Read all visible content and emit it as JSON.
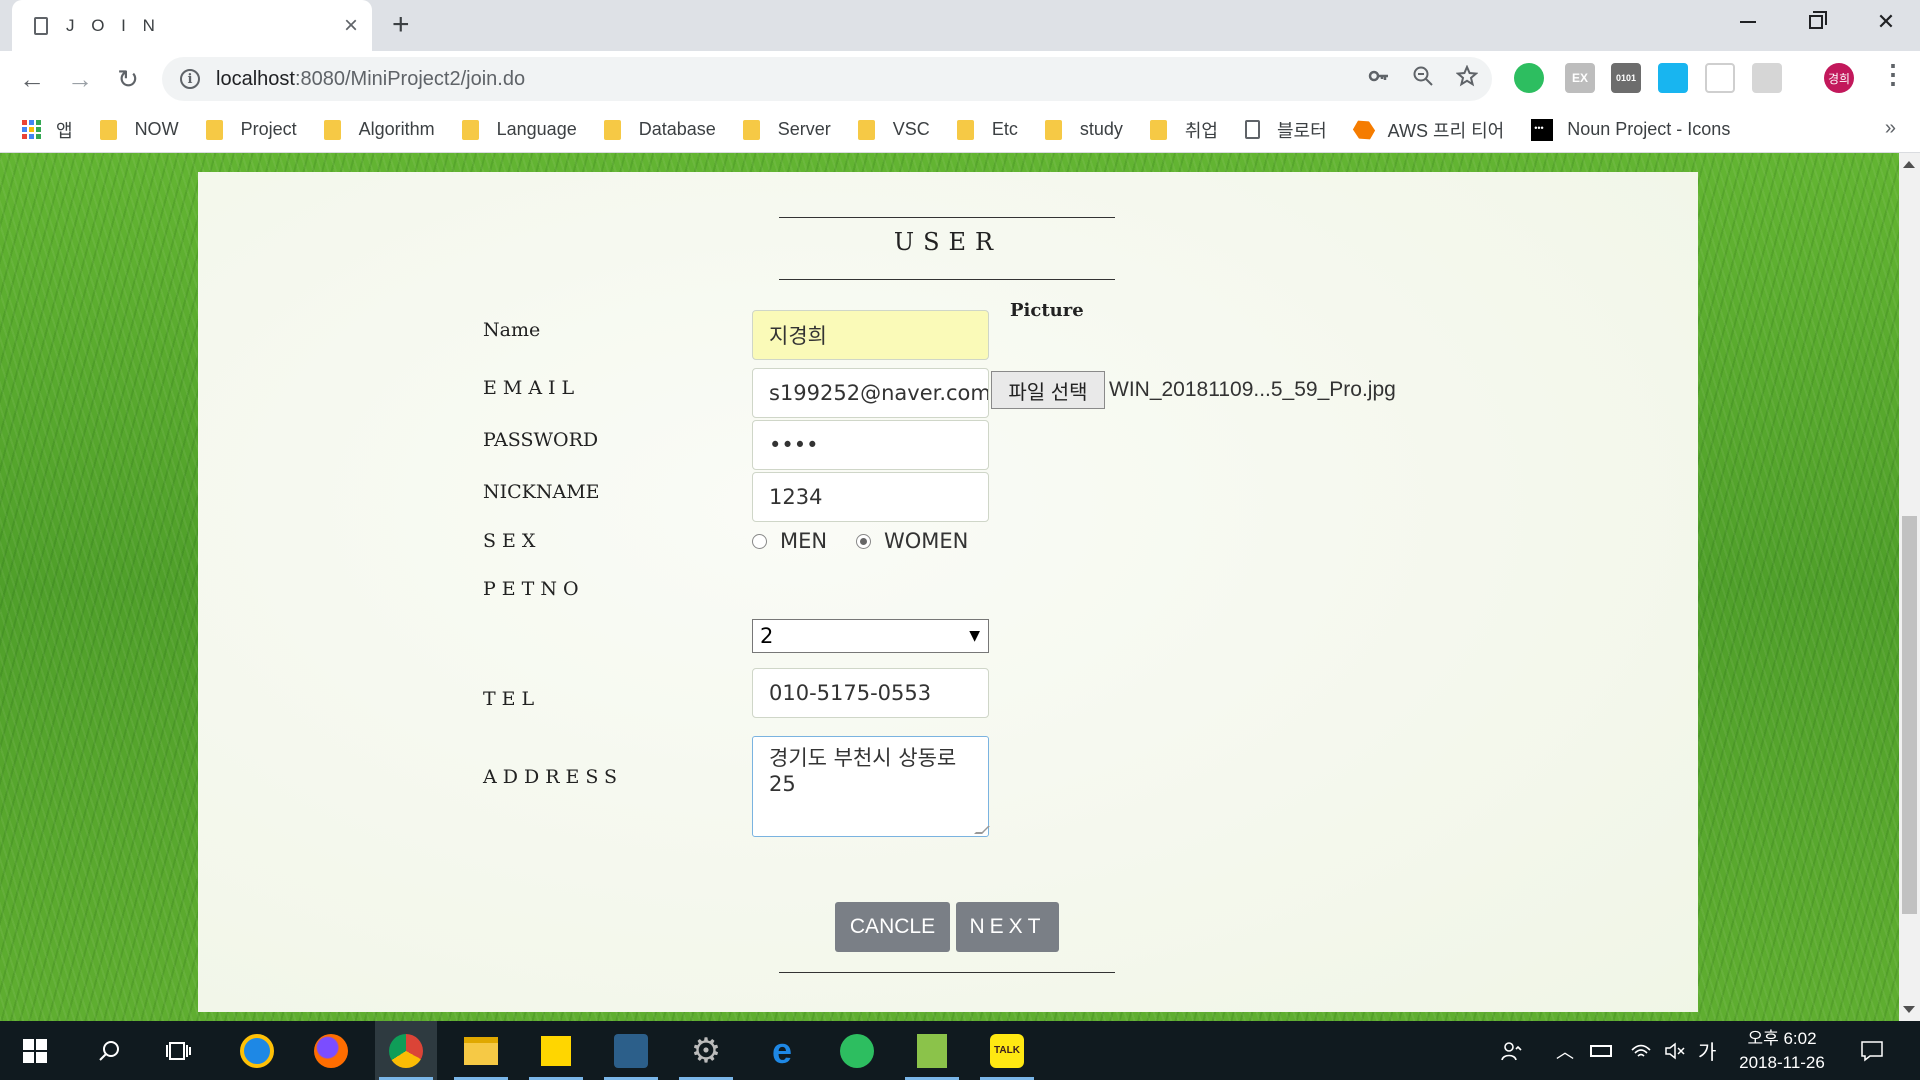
{
  "browser": {
    "tab_title": "J O I N",
    "tab_close": "×",
    "new_tab": "+",
    "url_host": "localhost",
    "url_rest": ":8080/MiniProject2/join.do",
    "window": {
      "minimize": "",
      "restore": "",
      "close": "✕"
    },
    "nav": {
      "back": "←",
      "forward": "→",
      "reload": "↻"
    },
    "omni_icons": [
      "key-icon",
      "zoom-out-icon",
      "star-icon"
    ],
    "profile_initial": "경희",
    "bookmarks_more": "»"
  },
  "bookmarks": [
    {
      "label": "앱",
      "icon": "apps-icon"
    },
    {
      "label": "NOW",
      "icon": "folder-icon"
    },
    {
      "label": "Project",
      "icon": "folder-icon"
    },
    {
      "label": "Algorithm",
      "icon": "folder-icon"
    },
    {
      "label": "Language",
      "icon": "folder-icon"
    },
    {
      "label": "Database",
      "icon": "folder-icon"
    },
    {
      "label": "Server",
      "icon": "folder-icon"
    },
    {
      "label": "VSC",
      "icon": "folder-icon"
    },
    {
      "label": "Etc",
      "icon": "folder-icon"
    },
    {
      "label": "study",
      "icon": "folder-icon"
    },
    {
      "label": "취업",
      "icon": "folder-icon"
    },
    {
      "label": "블로터",
      "icon": "page-icon"
    },
    {
      "label": "AWS 프리 티어",
      "icon": "aws-icon"
    },
    {
      "label": "Noun Project - Icons",
      "icon": "noun-project-icon"
    }
  ],
  "form": {
    "heading": "USER",
    "labels": {
      "name": "Name",
      "email": "EMAIL",
      "password": "PASSWORD",
      "nickname": "NICKNAME",
      "sex": "SEX",
      "petno": "PETNO",
      "tel": "TEL",
      "address": "ADDRESS",
      "picture": "Picture"
    },
    "values": {
      "name": "지경희",
      "email": "s199252@naver.com",
      "password": "••••",
      "nickname": "1234",
      "petno": "2",
      "tel": "010-5175-0553",
      "address": "경기도 부천시 상동로25"
    },
    "sex_options": [
      {
        "label": "MEN",
        "checked": false
      },
      {
        "label": "WOMEN",
        "checked": true
      }
    ],
    "file_button": "파일 선택",
    "file_name": "WIN_20181109...5_59_Pro.jpg",
    "cancel_label": "CANCLE",
    "next_label": "NEXT"
  },
  "taskbar": {
    "apps": [
      "start-icon",
      "search-icon",
      "task-view-icon",
      "internet-explorer-icon",
      "firefox-icon",
      "chrome-icon",
      "file-explorer-icon",
      "sticky-notes-icon",
      "mysql-workbench-icon",
      "settings-gear-icon",
      "edge-icon",
      "evernote-icon",
      "notepad-plus-icon",
      "kakaotalk-icon"
    ],
    "ime": "가",
    "time": "오후 6:02",
    "date": "2018-11-26"
  }
}
